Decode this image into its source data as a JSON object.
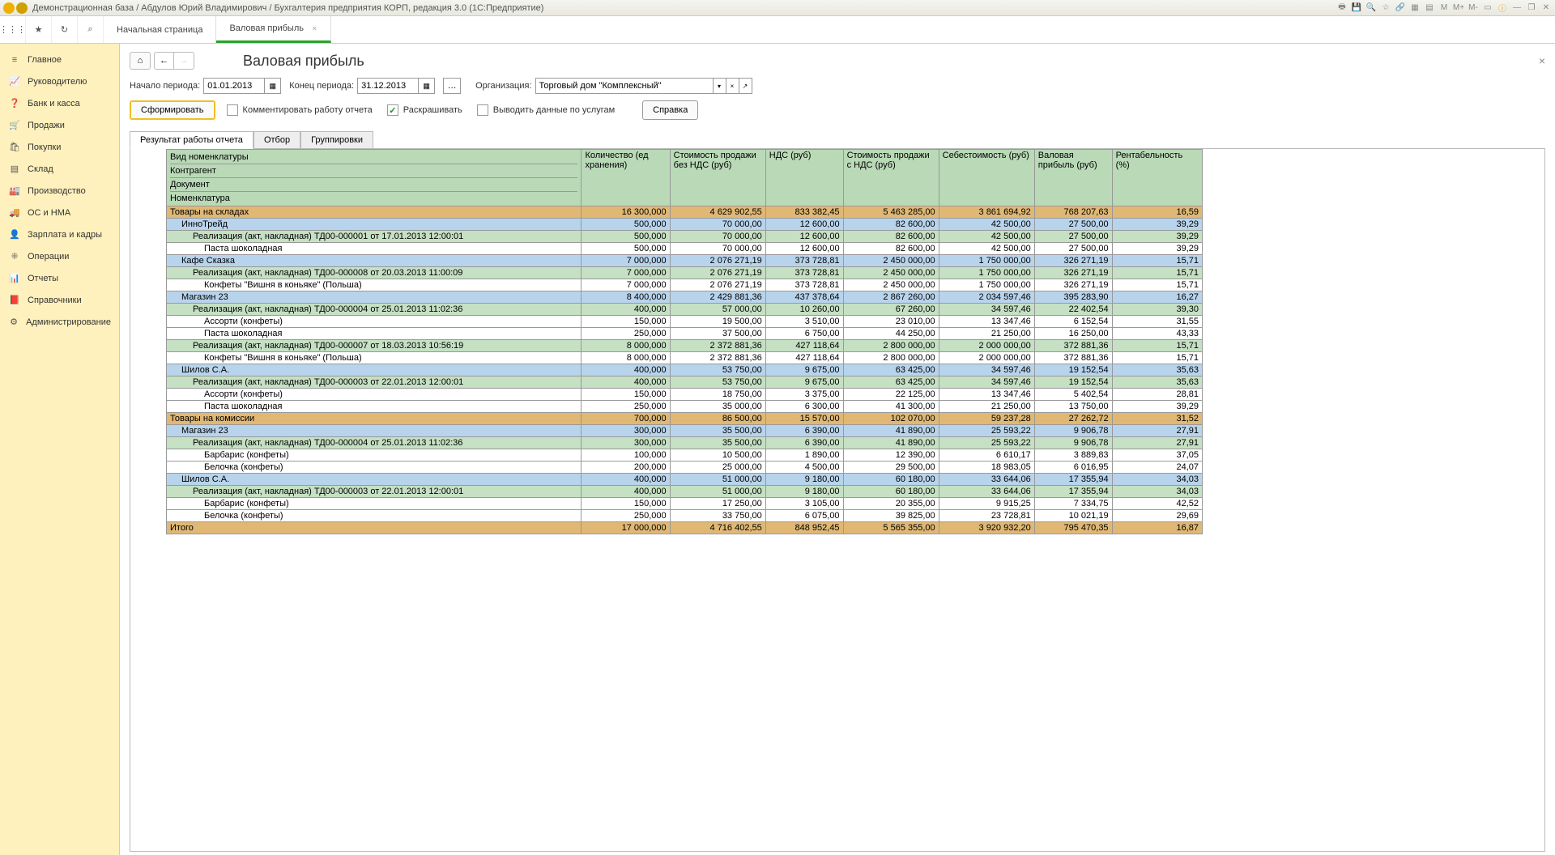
{
  "titlebar": {
    "text": "Демонстрационная база / Абдулов Юрий Владимирович / Бухгалтерия предприятия КОРП, редакция 3.0  (1С:Предприятие)"
  },
  "tabs": {
    "t0": "Начальная страница",
    "t1": "Валовая прибыль"
  },
  "sidebar": {
    "main": "Главное",
    "ruk": "Руководителю",
    "bank": "Банк и касса",
    "sales": "Продажи",
    "buy": "Покупки",
    "stock": "Склад",
    "prod": "Производство",
    "os": "ОС и НМА",
    "zp": "Зарплата и кадры",
    "op": "Операции",
    "rep": "Отчеты",
    "ref": "Справочники",
    "adm": "Администрирование"
  },
  "page": {
    "title": "Валовая прибыль"
  },
  "period": {
    "start_lbl": "Начало периода:",
    "start": "01.01.2013",
    "end_lbl": "Конец периода:",
    "end": "31.12.2013",
    "org_lbl": "Организация:",
    "org": "Торговый дом \"Комплексный\""
  },
  "actions": {
    "form": "Сформировать",
    "comment": "Комментировать работу отчета",
    "color": "Раскрашивать",
    "services": "Выводить данные по услугам",
    "help": "Справка"
  },
  "subtabs": {
    "res": "Результат работы отчета",
    "filter": "Отбор",
    "group": "Группировки"
  },
  "hdr": {
    "nom": "Вид номенклатуры",
    "contr": "Контрагент",
    "doc": "Документ",
    "nomencl": "Номенклатура",
    "qty": "Количество (ед хранения)",
    "cost": "Стоимость продажи без НДС (руб)",
    "nds": "НДС (руб)",
    "costnds": "Стоимость продажи с НДС (руб)",
    "seb": "Себестоимость (руб)",
    "val": "Валовая прибыль (руб)",
    "rent": "Рентабельность (%)"
  },
  "rows": [
    {
      "c": "orange",
      "l": 0,
      "n": "Товары на складах",
      "q": "16 300,000",
      "cost": "4 629 902,55",
      "nds": "833 382,45",
      "cn": "5 463 285,00",
      "seb": "3 861 694,92",
      "val": "768 207,63",
      "r": "16,59"
    },
    {
      "c": "blue",
      "l": 1,
      "n": "ИнноТрейд",
      "q": "500,000",
      "cost": "70 000,00",
      "nds": "12 600,00",
      "cn": "82 600,00",
      "seb": "42 500,00",
      "val": "27 500,00",
      "r": "39,29"
    },
    {
      "c": "green",
      "l": 2,
      "n": "Реализация (акт, накладная) ТД00-000001 от 17.01.2013 12:00:01",
      "q": "500,000",
      "cost": "70 000,00",
      "nds": "12 600,00",
      "cn": "82 600,00",
      "seb": "42 500,00",
      "val": "27 500,00",
      "r": "39,29"
    },
    {
      "c": "white",
      "l": 3,
      "n": "Паста шоколадная",
      "q": "500,000",
      "cost": "70 000,00",
      "nds": "12 600,00",
      "cn": "82 600,00",
      "seb": "42 500,00",
      "val": "27 500,00",
      "r": "39,29"
    },
    {
      "c": "blue",
      "l": 1,
      "n": "Кафе Сказка",
      "q": "7 000,000",
      "cost": "2 076 271,19",
      "nds": "373 728,81",
      "cn": "2 450 000,00",
      "seb": "1 750 000,00",
      "val": "326 271,19",
      "r": "15,71"
    },
    {
      "c": "green",
      "l": 2,
      "n": "Реализация (акт, накладная) ТД00-000008 от 20.03.2013 11:00:09",
      "q": "7 000,000",
      "cost": "2 076 271,19",
      "nds": "373 728,81",
      "cn": "2 450 000,00",
      "seb": "1 750 000,00",
      "val": "326 271,19",
      "r": "15,71"
    },
    {
      "c": "white",
      "l": 3,
      "n": "Конфеты \"Вишня в коньяке\"  (Польша)",
      "q": "7 000,000",
      "cost": "2 076 271,19",
      "nds": "373 728,81",
      "cn": "2 450 000,00",
      "seb": "1 750 000,00",
      "val": "326 271,19",
      "r": "15,71"
    },
    {
      "c": "blue",
      "l": 1,
      "n": "Магазин 23",
      "q": "8 400,000",
      "cost": "2 429 881,36",
      "nds": "437 378,64",
      "cn": "2 867 260,00",
      "seb": "2 034 597,46",
      "val": "395 283,90",
      "r": "16,27"
    },
    {
      "c": "green",
      "l": 2,
      "n": "Реализация (акт, накладная) ТД00-000004 от 25.01.2013 11:02:36",
      "q": "400,000",
      "cost": "57 000,00",
      "nds": "10 260,00",
      "cn": "67 260,00",
      "seb": "34 597,46",
      "val": "22 402,54",
      "r": "39,30"
    },
    {
      "c": "white",
      "l": 3,
      "n": "Ассорти (конфеты)",
      "q": "150,000",
      "cost": "19 500,00",
      "nds": "3 510,00",
      "cn": "23 010,00",
      "seb": "13 347,46",
      "val": "6 152,54",
      "r": "31,55"
    },
    {
      "c": "white",
      "l": 3,
      "n": "Паста шоколадная",
      "q": "250,000",
      "cost": "37 500,00",
      "nds": "6 750,00",
      "cn": "44 250,00",
      "seb": "21 250,00",
      "val": "16 250,00",
      "r": "43,33"
    },
    {
      "c": "green",
      "l": 2,
      "n": "Реализация (акт, накладная) ТД00-000007 от 18.03.2013 10:56:19",
      "q": "8 000,000",
      "cost": "2 372 881,36",
      "nds": "427 118,64",
      "cn": "2 800 000,00",
      "seb": "2 000 000,00",
      "val": "372 881,36",
      "r": "15,71"
    },
    {
      "c": "white",
      "l": 3,
      "n": "Конфеты \"Вишня в коньяке\"  (Польша)",
      "q": "8 000,000",
      "cost": "2 372 881,36",
      "nds": "427 118,64",
      "cn": "2 800 000,00",
      "seb": "2 000 000,00",
      "val": "372 881,36",
      "r": "15,71"
    },
    {
      "c": "blue",
      "l": 1,
      "n": "Шилов С.А.",
      "q": "400,000",
      "cost": "53 750,00",
      "nds": "9 675,00",
      "cn": "63 425,00",
      "seb": "34 597,46",
      "val": "19 152,54",
      "r": "35,63"
    },
    {
      "c": "green",
      "l": 2,
      "n": "Реализация (акт, накладная) ТД00-000003 от 22.01.2013 12:00:01",
      "q": "400,000",
      "cost": "53 750,00",
      "nds": "9 675,00",
      "cn": "63 425,00",
      "seb": "34 597,46",
      "val": "19 152,54",
      "r": "35,63"
    },
    {
      "c": "white",
      "l": 3,
      "n": "Ассорти (конфеты)",
      "q": "150,000",
      "cost": "18 750,00",
      "nds": "3 375,00",
      "cn": "22 125,00",
      "seb": "13 347,46",
      "val": "5 402,54",
      "r": "28,81"
    },
    {
      "c": "white",
      "l": 3,
      "n": "Паста шоколадная",
      "q": "250,000",
      "cost": "35 000,00",
      "nds": "6 300,00",
      "cn": "41 300,00",
      "seb": "21 250,00",
      "val": "13 750,00",
      "r": "39,29"
    },
    {
      "c": "orange",
      "l": 0,
      "n": "Товары на комиссии",
      "q": "700,000",
      "cost": "86 500,00",
      "nds": "15 570,00",
      "cn": "102 070,00",
      "seb": "59 237,28",
      "val": "27 262,72",
      "r": "31,52"
    },
    {
      "c": "blue",
      "l": 1,
      "n": "Магазин 23",
      "q": "300,000",
      "cost": "35 500,00",
      "nds": "6 390,00",
      "cn": "41 890,00",
      "seb": "25 593,22",
      "val": "9 906,78",
      "r": "27,91"
    },
    {
      "c": "green",
      "l": 2,
      "n": "Реализация (акт, накладная) ТД00-000004 от 25.01.2013 11:02:36",
      "q": "300,000",
      "cost": "35 500,00",
      "nds": "6 390,00",
      "cn": "41 890,00",
      "seb": "25 593,22",
      "val": "9 906,78",
      "r": "27,91"
    },
    {
      "c": "white",
      "l": 3,
      "n": "Барбарис (конфеты)",
      "q": "100,000",
      "cost": "10 500,00",
      "nds": "1 890,00",
      "cn": "12 390,00",
      "seb": "6 610,17",
      "val": "3 889,83",
      "r": "37,05"
    },
    {
      "c": "white",
      "l": 3,
      "n": "Белочка (конфеты)",
      "q": "200,000",
      "cost": "25 000,00",
      "nds": "4 500,00",
      "cn": "29 500,00",
      "seb": "18 983,05",
      "val": "6 016,95",
      "r": "24,07"
    },
    {
      "c": "blue",
      "l": 1,
      "n": "Шилов С.А.",
      "q": "400,000",
      "cost": "51 000,00",
      "nds": "9 180,00",
      "cn": "60 180,00",
      "seb": "33 644,06",
      "val": "17 355,94",
      "r": "34,03"
    },
    {
      "c": "green",
      "l": 2,
      "n": "Реализация (акт, накладная) ТД00-000003 от 22.01.2013 12:00:01",
      "q": "400,000",
      "cost": "51 000,00",
      "nds": "9 180,00",
      "cn": "60 180,00",
      "seb": "33 644,06",
      "val": "17 355,94",
      "r": "34,03"
    },
    {
      "c": "white",
      "l": 3,
      "n": "Барбарис (конфеты)",
      "q": "150,000",
      "cost": "17 250,00",
      "nds": "3 105,00",
      "cn": "20 355,00",
      "seb": "9 915,25",
      "val": "7 334,75",
      "r": "42,52"
    },
    {
      "c": "white",
      "l": 3,
      "n": "Белочка (конфеты)",
      "q": "250,000",
      "cost": "33 750,00",
      "nds": "6 075,00",
      "cn": "39 825,00",
      "seb": "23 728,81",
      "val": "10 021,19",
      "r": "29,69"
    }
  ],
  "total": {
    "n": "Итого",
    "q": "17 000,000",
    "cost": "4 716 402,55",
    "nds": "848 952,45",
    "cn": "5 565 355,00",
    "seb": "3 920 932,20",
    "val": "795 470,35",
    "r": "16,87"
  }
}
